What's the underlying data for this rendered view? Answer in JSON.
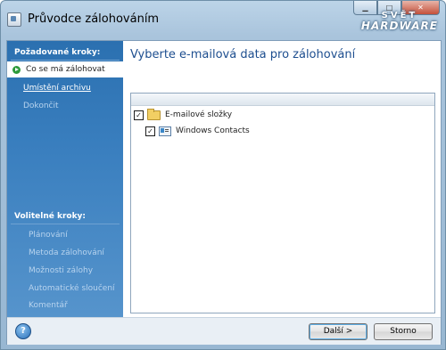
{
  "window": {
    "title": "Průvodce zálohováním",
    "brand_line1": "SVĚT",
    "brand_line2": "HARDWARE",
    "minimize_glyph": "▁",
    "maximize_glyph": "□",
    "close_glyph": "✕"
  },
  "sidebar": {
    "required_heading": "Požadované kroky:",
    "required_items": [
      {
        "label": "Co se má zálohovat",
        "state": "active"
      },
      {
        "label": "Umístění archivu",
        "state": "link"
      },
      {
        "label": "Dokončit",
        "state": "disabled"
      }
    ],
    "optional_heading": "Volitelné kroky:",
    "optional_items": [
      {
        "label": "Plánování"
      },
      {
        "label": "Metoda zálohování"
      },
      {
        "label": "Možnosti zálohy"
      },
      {
        "label": "Automatické sloučení"
      },
      {
        "label": "Komentář"
      }
    ]
  },
  "main": {
    "title": "Vyberte e-mailová data pro zálohování",
    "tree": [
      {
        "label": "E-mailové složky",
        "checked": true,
        "icon": "folder-icon",
        "check_glyph": "✓"
      },
      {
        "label": "Windows Contacts",
        "checked": true,
        "icon": "contacts-icon",
        "check_glyph": "✓"
      }
    ]
  },
  "footer": {
    "help_glyph": "?",
    "next_label": "Další >",
    "cancel_label": "Storno"
  },
  "colors": {
    "sidebar_top": "#2b70b0",
    "sidebar_bottom": "#5694cc",
    "title_blue": "#1d4e8f"
  }
}
